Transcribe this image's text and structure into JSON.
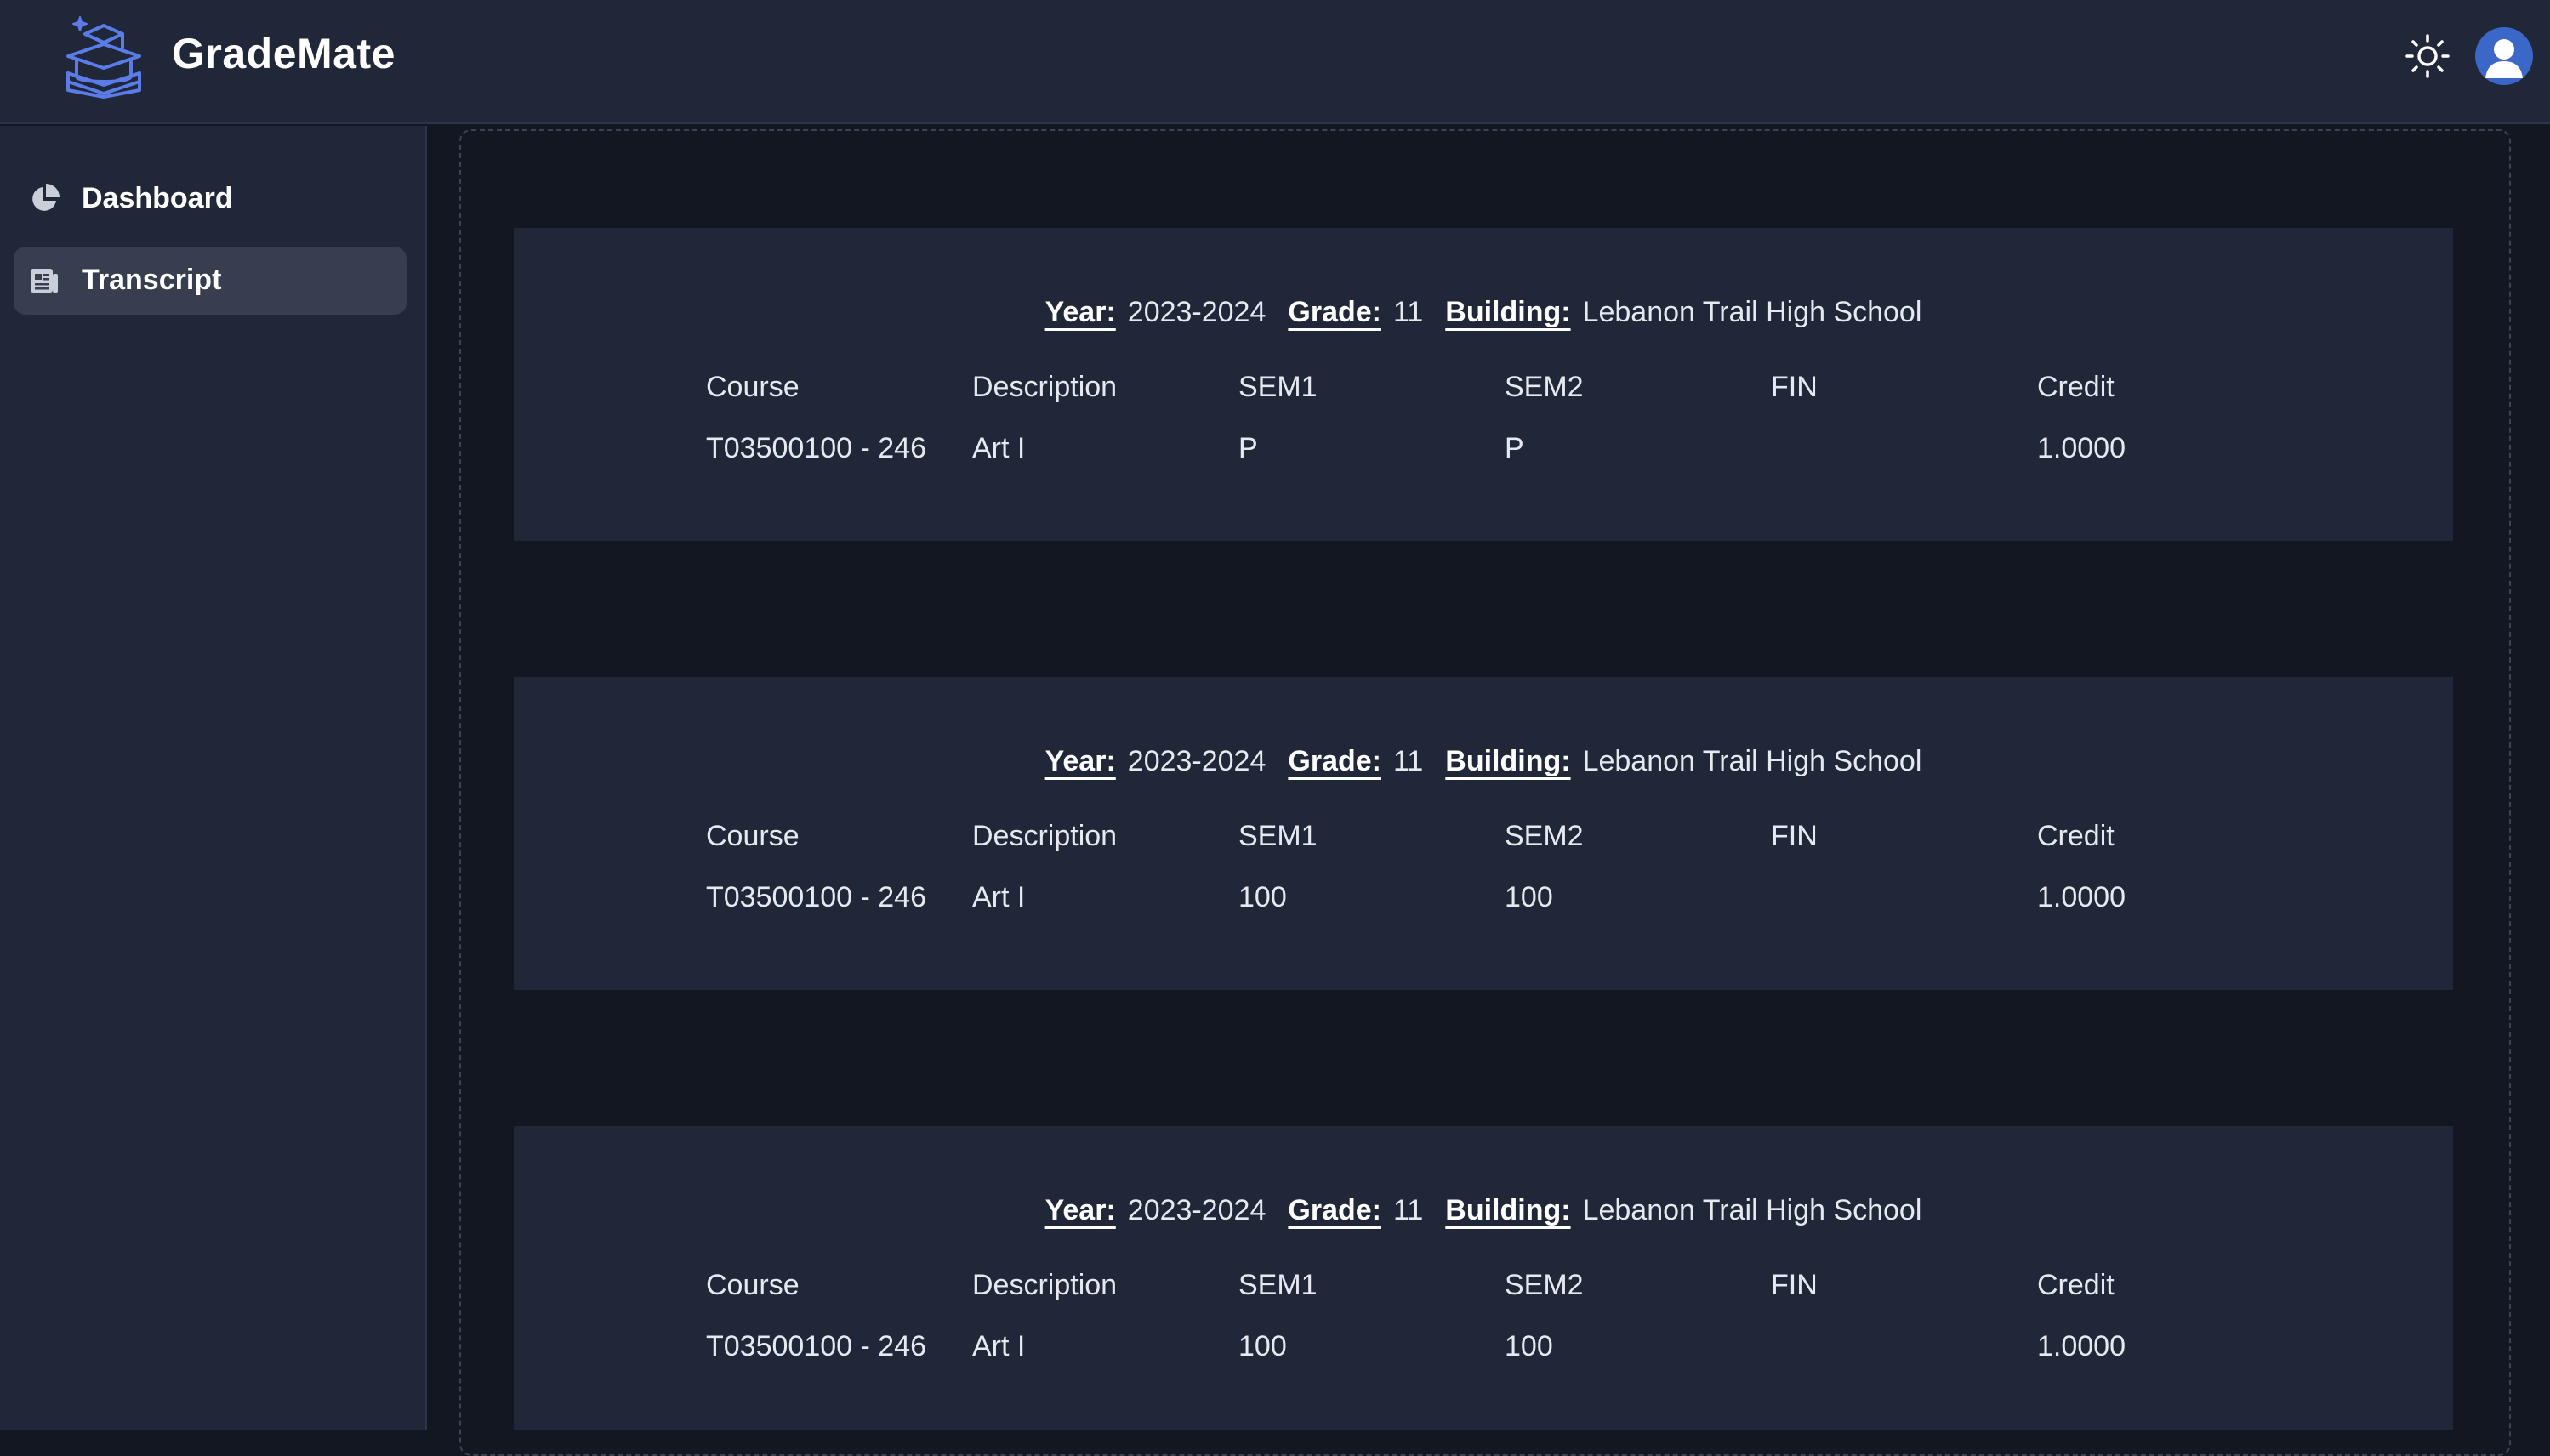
{
  "app": {
    "title": "GradeMate"
  },
  "colors": {
    "accent": "#5b7be8",
    "avatar": "#3b67c9",
    "sidebar_active": "#363e50"
  },
  "header": {
    "theme_icon": "sun-icon",
    "avatar_icon": "user-avatar-icon"
  },
  "sidebar": {
    "items": [
      {
        "label": "Dashboard",
        "icon": "pie-chart-icon",
        "active": false
      },
      {
        "label": "Transcript",
        "icon": "document-icon",
        "active": true
      }
    ]
  },
  "transcript": {
    "header_labels": {
      "year": "Year:",
      "grade": "Grade:",
      "building": "Building:"
    },
    "columns": [
      "Course",
      "Description",
      "SEM1",
      "SEM2",
      "FIN",
      "Credit"
    ],
    "records": [
      {
        "year": "2023-2024",
        "grade": "11",
        "building": "Lebanon Trail High School",
        "rows": [
          [
            "T03500100 - 246",
            "Art I",
            "P",
            "P",
            "",
            "1.0000"
          ]
        ]
      },
      {
        "year": "2023-2024",
        "grade": "11",
        "building": "Lebanon Trail High School",
        "rows": [
          [
            "T03500100 - 246",
            "Art I",
            "100",
            "100",
            "",
            "1.0000"
          ]
        ]
      },
      {
        "year": "2023-2024",
        "grade": "11",
        "building": "Lebanon Trail High School",
        "rows": [
          [
            "T03500100 - 246",
            "Art I",
            "100",
            "100",
            "",
            "1.0000"
          ]
        ]
      }
    ]
  }
}
